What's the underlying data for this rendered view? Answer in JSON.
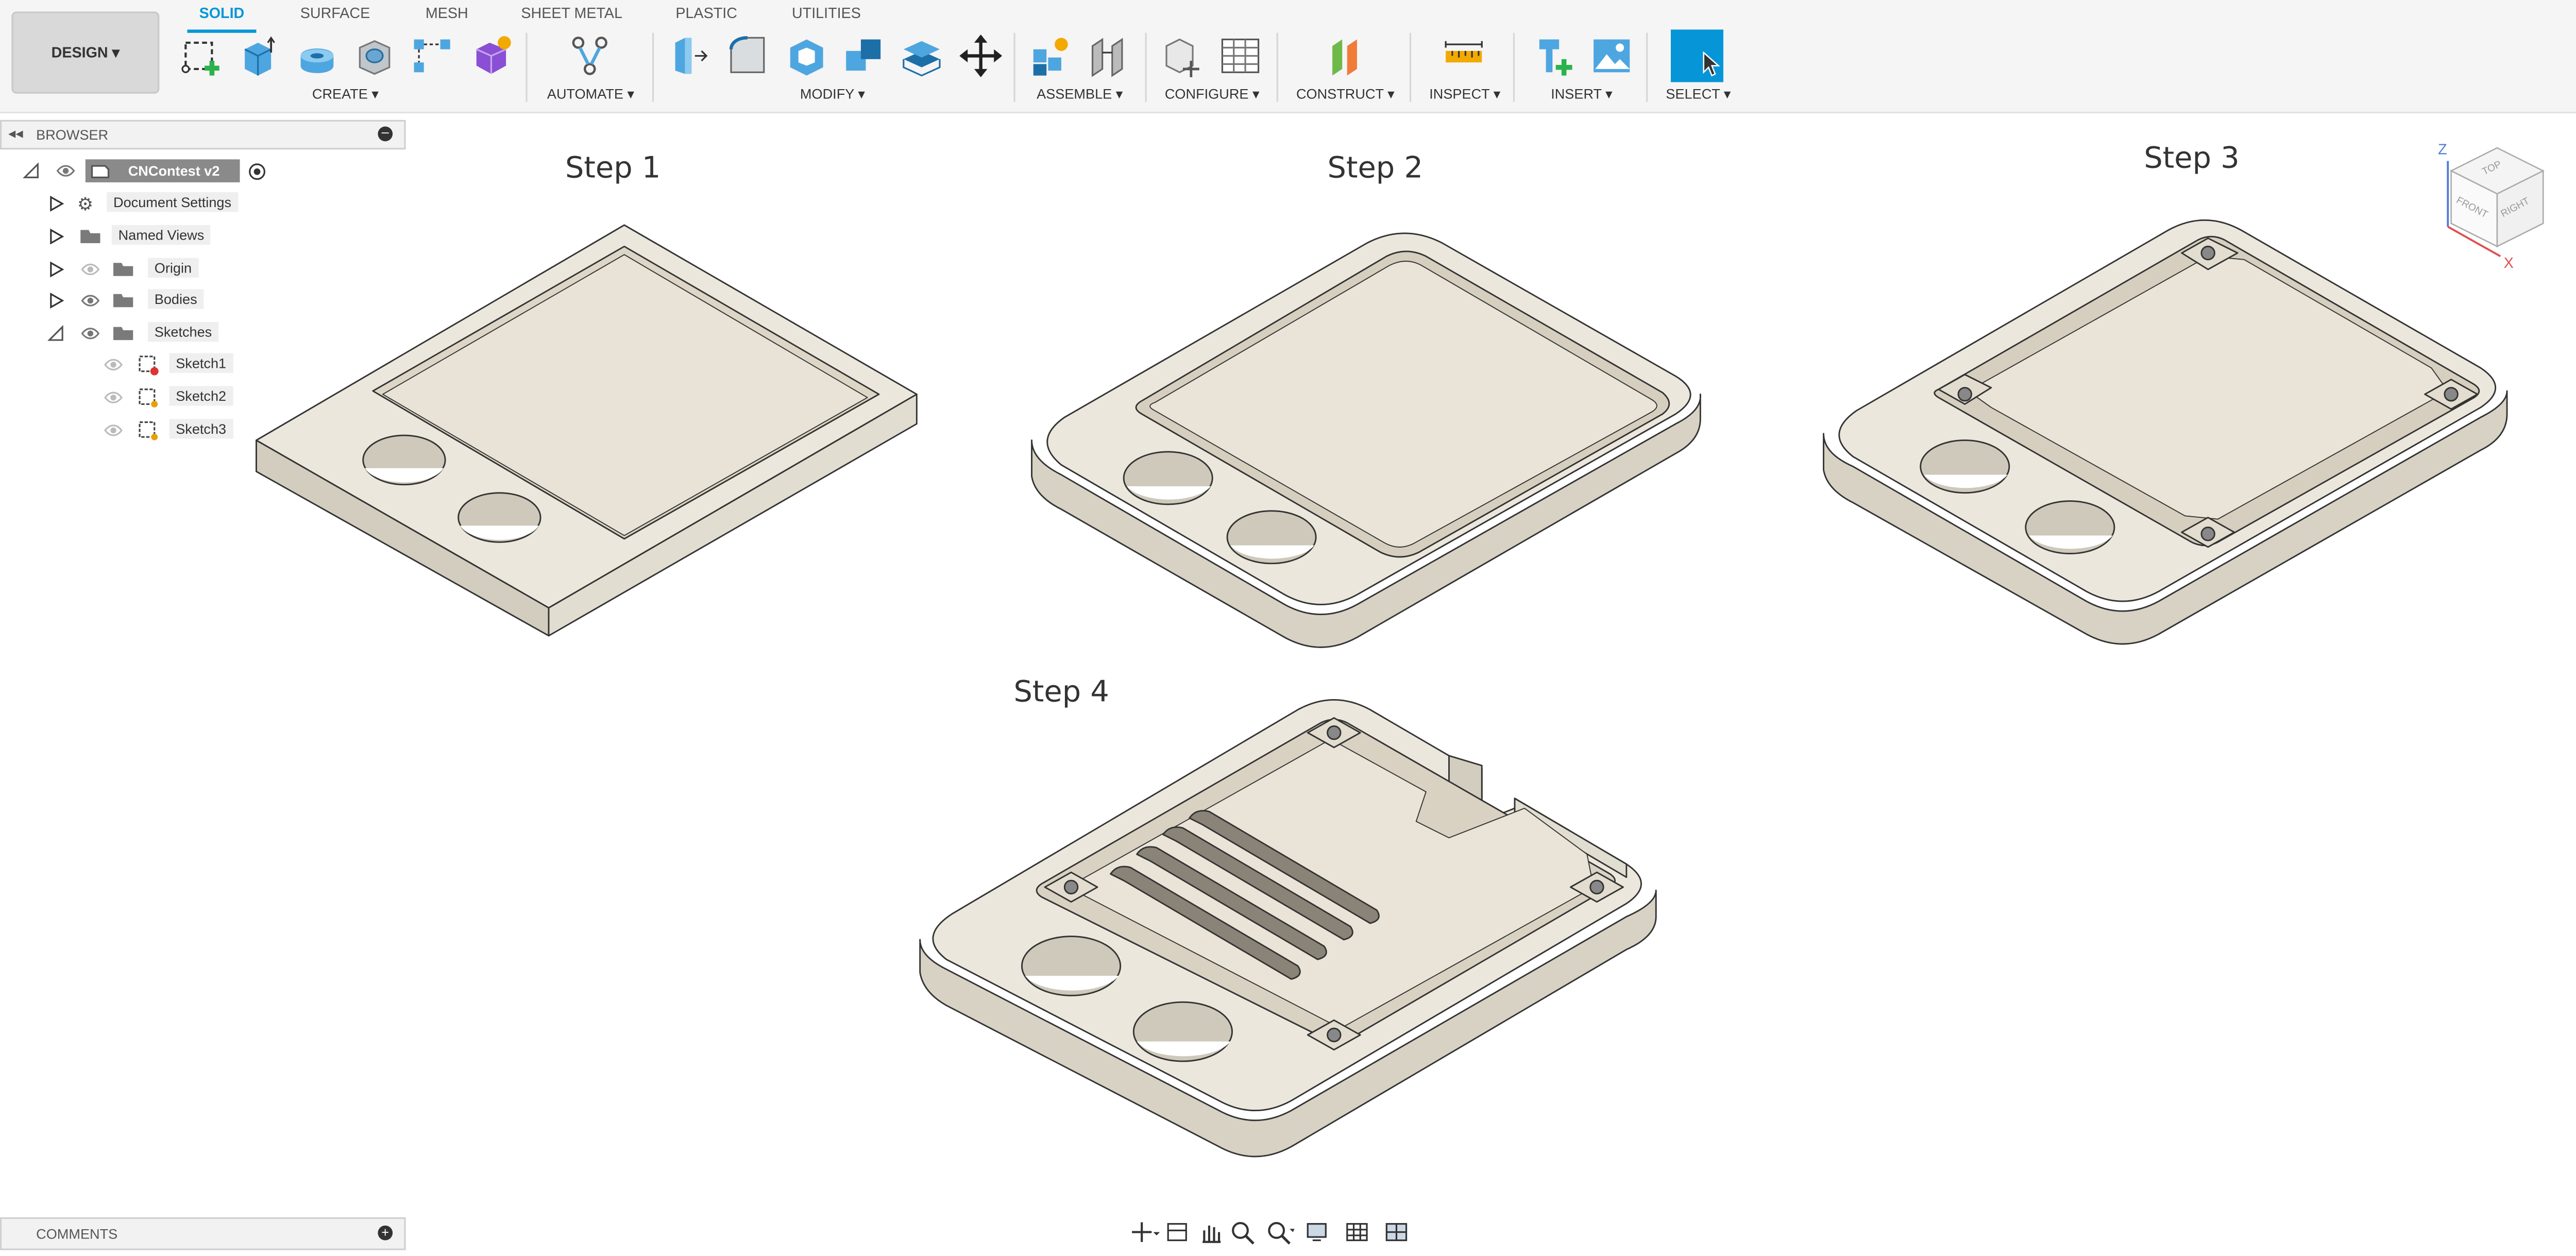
{
  "toolbar": {
    "design_label": "DESIGN ▾",
    "tabs": [
      "SOLID",
      "SURFACE",
      "MESH",
      "SHEET METAL",
      "PLASTIC",
      "UTILITIES"
    ],
    "active_tab": "SOLID",
    "groups": {
      "create": "CREATE ▾",
      "automate": "AUTOMATE ▾",
      "modify": "MODIFY ▾",
      "assemble": "ASSEMBLE ▾",
      "configure": "CONFIGURE ▾",
      "construct": "CONSTRUCT ▾",
      "inspect": "INSPECT ▾",
      "insert": "INSERT ▾",
      "select": "SELECT ▾"
    },
    "accent_color": "#0696d7"
  },
  "browser": {
    "title": "BROWSER",
    "root": "CNContest v2",
    "items": [
      {
        "label": "Document Settings",
        "icon": "gear-icon"
      },
      {
        "label": "Named Views",
        "icon": "folder-icon"
      },
      {
        "label": "Origin",
        "icon": "folder-icon"
      },
      {
        "label": "Bodies",
        "icon": "folder-icon"
      },
      {
        "label": "Sketches",
        "icon": "folder-icon"
      }
    ],
    "sketches": [
      "Sketch1",
      "Sketch2",
      "Sketch3"
    ]
  },
  "viewport": {
    "steps": [
      "Step 1",
      "Step 2",
      "Step 3",
      "Step 4"
    ],
    "viewcube": {
      "top": "TOP",
      "front": "FRONT",
      "right": "RIGHT",
      "axis_z": "Z",
      "axis_x": "X"
    },
    "model_color": "#ece7dc"
  },
  "comments": {
    "title": "COMMENTS"
  }
}
